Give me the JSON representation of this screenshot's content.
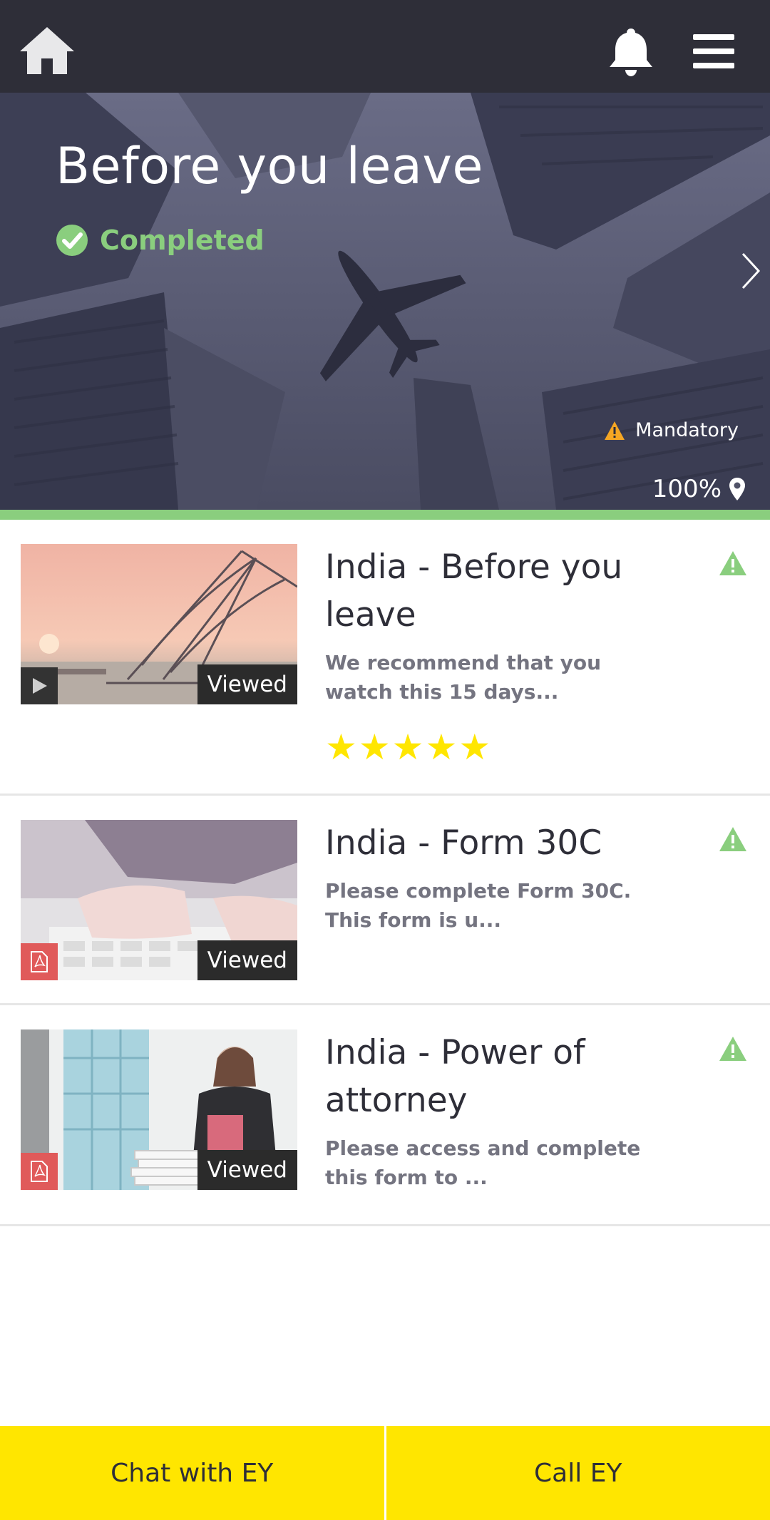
{
  "topbar": {
    "home_icon": "home-icon",
    "bell_icon": "bell-icon",
    "menu_icon": "hamburger-menu-icon"
  },
  "hero": {
    "title": "Before you leave",
    "status": "Completed",
    "mandatory_label": "Mandatory",
    "progress_label": "100%",
    "progress_value": 100,
    "status_color": "#8ace7e"
  },
  "items": [
    {
      "title": "India - Before you leave",
      "description": "We recommend that you watch this 15 days...",
      "badge": "Viewed",
      "media_type": "video",
      "rating": 5
    },
    {
      "title": "India - Form 30C",
      "description": "Please complete Form 30C. This form is u...",
      "badge": "Viewed",
      "media_type": "pdf"
    },
    {
      "title": "India - Power of attorney",
      "description": "Please access and complete this form to ...",
      "badge": "Viewed",
      "media_type": "pdf"
    }
  ],
  "footer": {
    "chat_label": "Chat with EY",
    "call_label": "Call EY"
  },
  "colors": {
    "brand_yellow": "#ffe600",
    "dark": "#2e2e38",
    "success_green": "#8ace7e",
    "warning_orange": "#f5a623"
  }
}
